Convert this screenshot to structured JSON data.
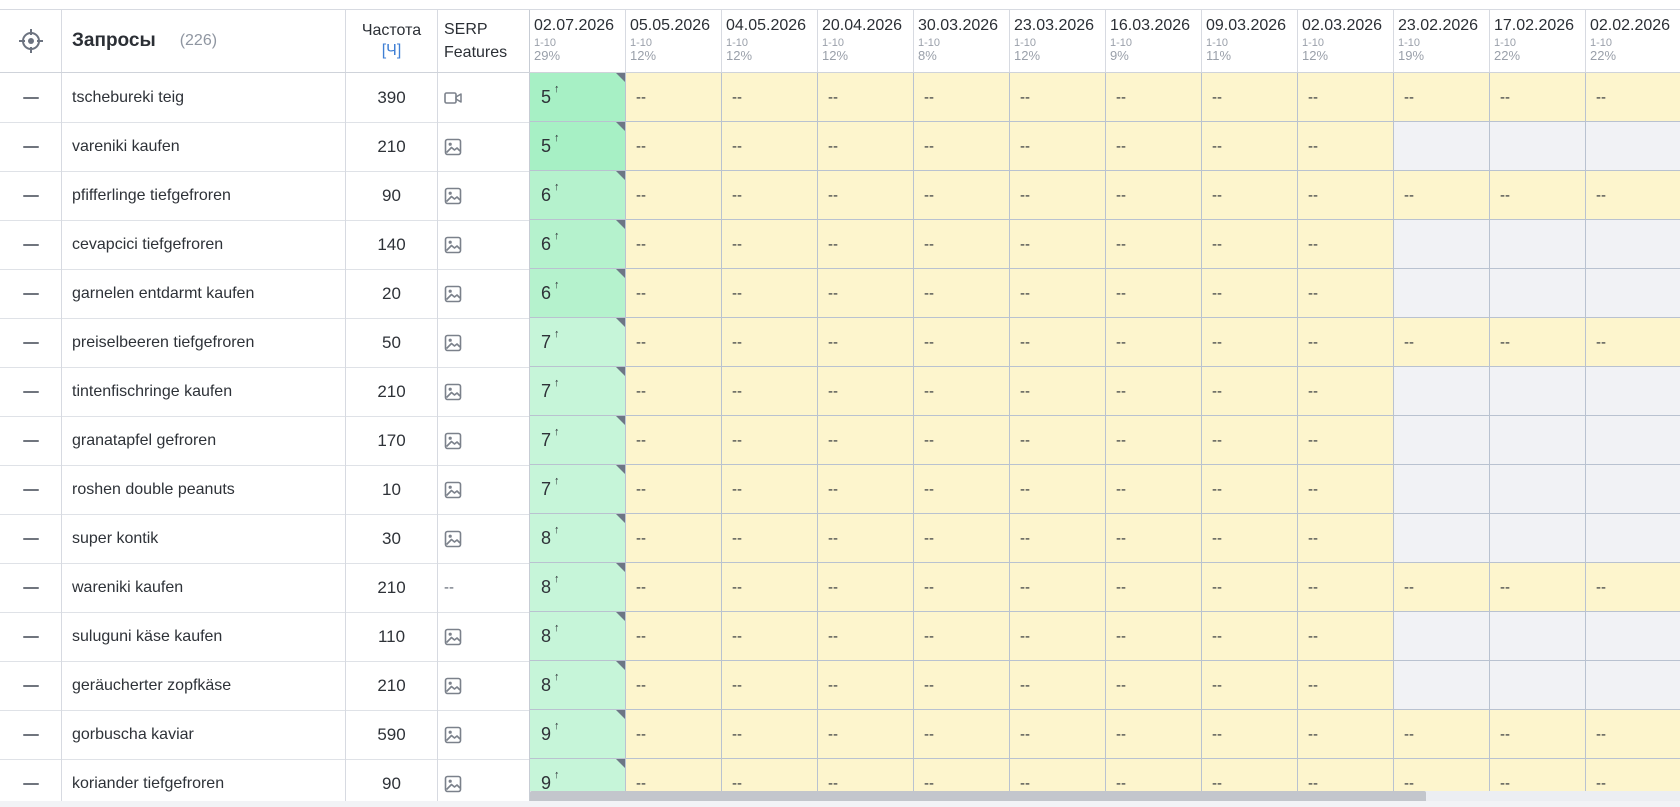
{
  "header": {
    "target_icon": "crosshair-icon",
    "queries_label": "Запросы",
    "queries_count": "(226)",
    "frequency_label": "Частота",
    "frequency_sub": "[Ч]",
    "serp_label_1": "SERP",
    "serp_label_2": "Features"
  },
  "dates": [
    {
      "date": "02.07.2026",
      "range": "1-10",
      "pct": "29%"
    },
    {
      "date": "05.05.2026",
      "range": "1-10",
      "pct": "12%"
    },
    {
      "date": "04.05.2026",
      "range": "1-10",
      "pct": "12%"
    },
    {
      "date": "20.04.2026",
      "range": "1-10",
      "pct": "12%"
    },
    {
      "date": "30.03.2026",
      "range": "1-10",
      "pct": "8%"
    },
    {
      "date": "23.03.2026",
      "range": "1-10",
      "pct": "12%"
    },
    {
      "date": "16.03.2026",
      "range": "1-10",
      "pct": "9%"
    },
    {
      "date": "09.03.2026",
      "range": "1-10",
      "pct": "11%"
    },
    {
      "date": "02.03.2026",
      "range": "1-10",
      "pct": "12%"
    },
    {
      "date": "23.02.2026",
      "range": "1-10",
      "pct": "19%"
    },
    {
      "date": "17.02.2026",
      "range": "1-10",
      "pct": "22%"
    },
    {
      "date": "02.02.2026",
      "range": "1-10",
      "pct": "22%"
    }
  ],
  "cell_empty": "--",
  "up_arrow": "↑",
  "rows": [
    {
      "query": "tschebureki teig",
      "freq": "390",
      "serp": "video",
      "pos": "5",
      "dashes": 12
    },
    {
      "query": "vareniki kaufen",
      "freq": "210",
      "serp": "image",
      "pos": "5",
      "dashes": 9
    },
    {
      "query": "pfifferlinge tiefgefroren",
      "freq": "90",
      "serp": "image",
      "pos": "6",
      "dashes": 12
    },
    {
      "query": "cevapcici tiefgefroren",
      "freq": "140",
      "serp": "image",
      "pos": "6",
      "dashes": 9
    },
    {
      "query": "garnelen entdarmt kaufen",
      "freq": "20",
      "serp": "image",
      "pos": "6",
      "dashes": 9
    },
    {
      "query": "preiselbeeren tiefgefroren",
      "freq": "50",
      "serp": "image",
      "pos": "7",
      "dashes": 12
    },
    {
      "query": "tintenfischringe kaufen",
      "freq": "210",
      "serp": "image",
      "pos": "7",
      "dashes": 9
    },
    {
      "query": "granatapfel gefroren",
      "freq": "170",
      "serp": "image",
      "pos": "7",
      "dashes": 9
    },
    {
      "query": "roshen double peanuts",
      "freq": "10",
      "serp": "image",
      "pos": "7",
      "dashes": 9
    },
    {
      "query": "super kontik",
      "freq": "30",
      "serp": "image",
      "pos": "8",
      "dashes": 9
    },
    {
      "query": "wareniki kaufen",
      "freq": "210",
      "serp": "--",
      "pos": "8",
      "dashes": 12
    },
    {
      "query": "suluguni käse kaufen",
      "freq": "110",
      "serp": "image",
      "pos": "8",
      "dashes": 9
    },
    {
      "query": "geräucherter zopfkäse",
      "freq": "210",
      "serp": "image",
      "pos": "8",
      "dashes": 9
    },
    {
      "query": "gorbuscha kaviar",
      "freq": "590",
      "serp": "image",
      "pos": "9",
      "dashes": 12
    },
    {
      "query": "koriander tiefgefroren",
      "freq": "90",
      "serp": "image",
      "pos": "9",
      "dashes": 12
    }
  ],
  "colors": {
    "first_date_green_strong": "#a7f0c5",
    "first_date_green_light": "#c6f5d9",
    "yellow": "#fdf5cd",
    "gray": "#f1f2f5",
    "accent": "#3f7fd4"
  }
}
